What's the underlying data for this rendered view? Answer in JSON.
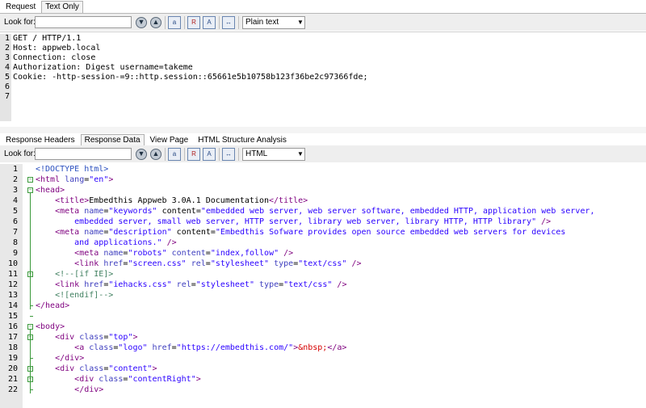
{
  "top_tabs": [
    "Request",
    "Text Only"
  ],
  "top_toolbar": {
    "look_for_label": "Look for:",
    "search_value": "",
    "format_value": "Plain text"
  },
  "request_lines": [
    "GET / HTTP/1.1",
    "Host: appweb.local",
    "Connection: close",
    "Authorization: Digest username=takeme",
    "Cookie: -http-session-=9::http.session::65661e5b10758b123f36be2c97366fde;",
    "",
    ""
  ],
  "request_line_numbers": [
    "1",
    "2",
    "3",
    "4",
    "5",
    "6",
    "7"
  ],
  "bottom_tabs": [
    "Response Headers",
    "Response Data",
    "View Page",
    "HTML Structure Analysis"
  ],
  "bottom_toolbar": {
    "look_for_label": "Look for:",
    "search_value": "",
    "format_value": "HTML"
  },
  "code_line_numbers": [
    "1",
    "2",
    "3",
    "4",
    "5",
    "6",
    "7",
    "8",
    "9",
    "10",
    "11",
    "12",
    "13",
    "14",
    "15",
    "16",
    "17",
    "18",
    "19",
    "20",
    "21",
    "22"
  ],
  "code_lines": [
    "<!DOCTYPE html>",
    "<html lang=\"en\">",
    "<head>",
    "    <title>Embedthis Appweb 3.0A.1 Documentation</title>",
    "    <meta name=\"keywords\" content=\"embedded web server, web server software, embedded HTTP, application web server,",
    "        embedded server, small web server, HTTP server, library web server, library HTTP, HTTP library\" />",
    "    <meta name=\"description\" content=\"Embedthis Sofware provides open source embedded web servers for devices",
    "        and applications.\" />",
    "        <meta name=\"robots\" content=\"index,follow\" />",
    "        <link href=\"screen.css\" rel=\"stylesheet\" type=\"text/css\" />",
    "    <!--[if IE]>",
    "    <link href=\"iehacks.css\" rel=\"stylesheet\" type=\"text/css\" />",
    "    <![endif]-->",
    "</head>",
    "",
    "<body>",
    "    <div class=\"top\">",
    "        <a class=\"logo\" href=\"https://embedthis.com/\">&nbsp;</a>",
    "    </div>",
    "    <div class=\"content\">",
    "        <div class=\"contentRight\">",
    "        </div>"
  ],
  "icons": [
    "find-next-icon",
    "find-previous-icon",
    "match-case-icon",
    "regex-icon",
    "whole-word-icon",
    "wrap-icon"
  ]
}
